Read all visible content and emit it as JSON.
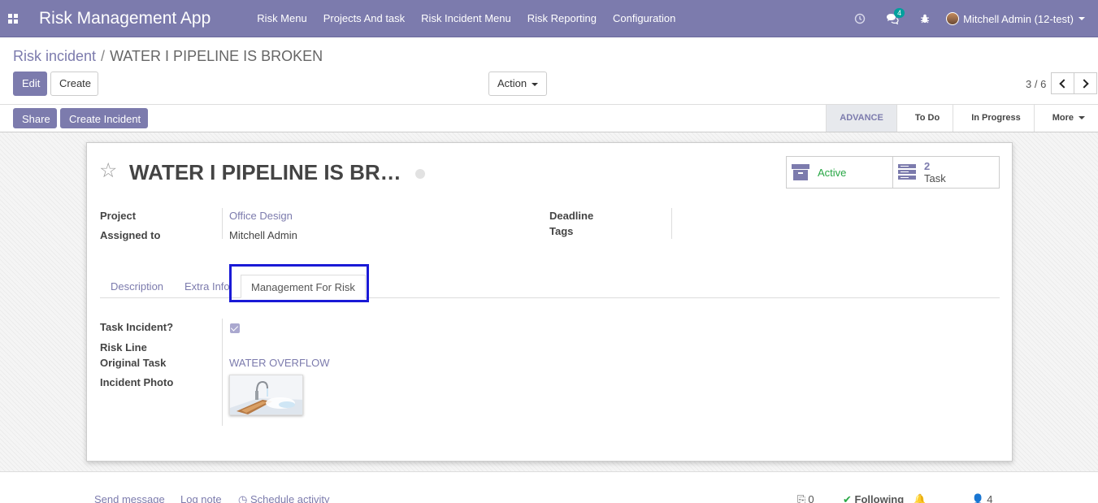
{
  "navbar": {
    "brand": "Risk Management App",
    "menu": [
      "Risk Menu",
      "Projects And task",
      "Risk Incident Menu",
      "Risk Reporting",
      "Configuration"
    ],
    "messages_count": "4",
    "user": "Mitchell Admin (12-test)",
    "accent": "#7c7bad"
  },
  "breadcrumb": {
    "parent": "Risk incident",
    "current": "WATER I PIPELINE IS BROKEN"
  },
  "buttons": {
    "edit": "Edit",
    "create": "Create",
    "action": "Action",
    "share": "Share",
    "create_incident": "Create Incident"
  },
  "pager": {
    "value": "3 / 6"
  },
  "stages": {
    "active": "ADVANCE",
    "items": [
      "To Do",
      "In Progress"
    ],
    "more": "More"
  },
  "record": {
    "title": "WATER I PIPELINE IS BR…",
    "smart_active": "Active",
    "smart_task_count": "2",
    "smart_task_label": "Task"
  },
  "fields": {
    "project_label": "Project",
    "project_value": "Office Design",
    "assigned_label": "Assigned to",
    "assigned_value": "Mitchell Admin",
    "deadline_label": "Deadline",
    "tags_label": "Tags"
  },
  "tabs": [
    "Description",
    "Extra Info",
    "Management For Risk"
  ],
  "management": {
    "task_incident_label": "Task Incident?",
    "task_incident_checked": true,
    "risk_line_label": "Risk Line",
    "original_task_label": "Original Task",
    "original_task_value": "WATER OVERFLOW",
    "incident_photo_label": "Incident Photo"
  },
  "chatter": {
    "send_message": "Send message",
    "log_note": "Log note",
    "schedule_activity": "Schedule activity",
    "attachments": "0",
    "following": "Following",
    "followers": "4"
  }
}
